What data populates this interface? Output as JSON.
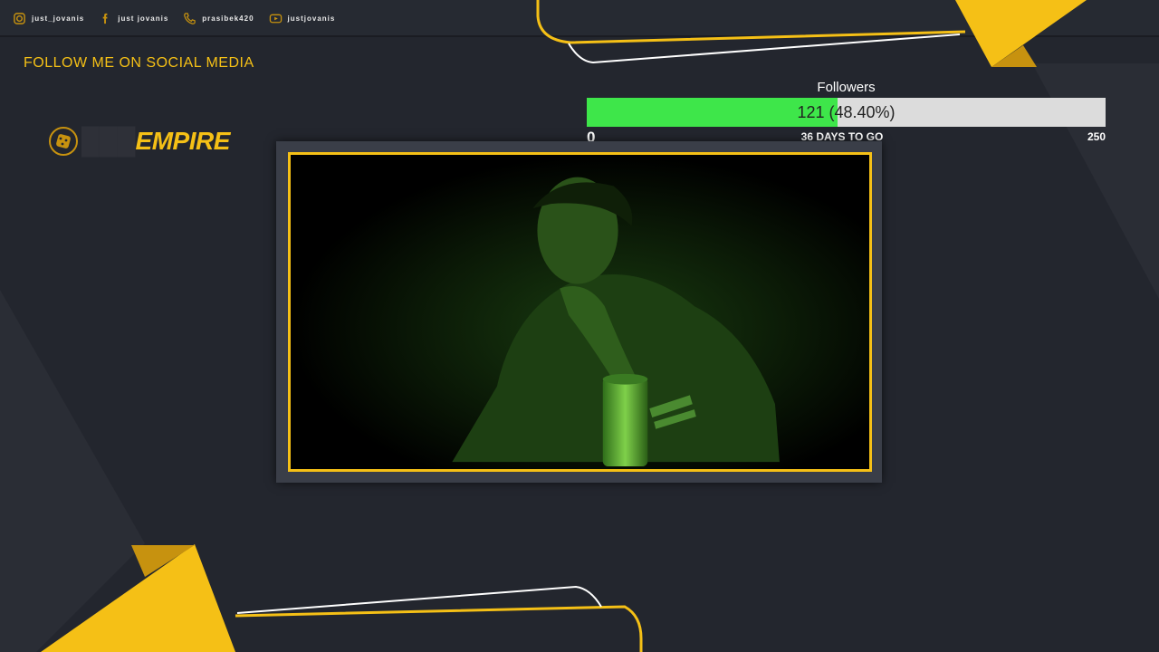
{
  "socials": [
    {
      "icon": "instagram-icon",
      "handle": "just_jovanis"
    },
    {
      "icon": "facebook-icon",
      "handle": "just jovanis"
    },
    {
      "icon": "phone-icon",
      "handle": "prasibek420"
    },
    {
      "icon": "youtube-icon",
      "handle": "justjovanis"
    }
  ],
  "follow_text": "FOLLOW ME ON SOCIAL MEDIA",
  "logo": {
    "text": "EMPIRE",
    "icon": "dice-icon"
  },
  "goal": {
    "title": "Followers",
    "progress_label": "121 (48.40%)",
    "current": 121,
    "target": 250,
    "percent": 48.4,
    "start": "0",
    "end": "250",
    "days_left": "36 DAYS TO GO"
  },
  "colors": {
    "accent": "#f5c016",
    "background": "#23262e",
    "progress": "#3ee64a",
    "track": "#dcdcdc"
  }
}
